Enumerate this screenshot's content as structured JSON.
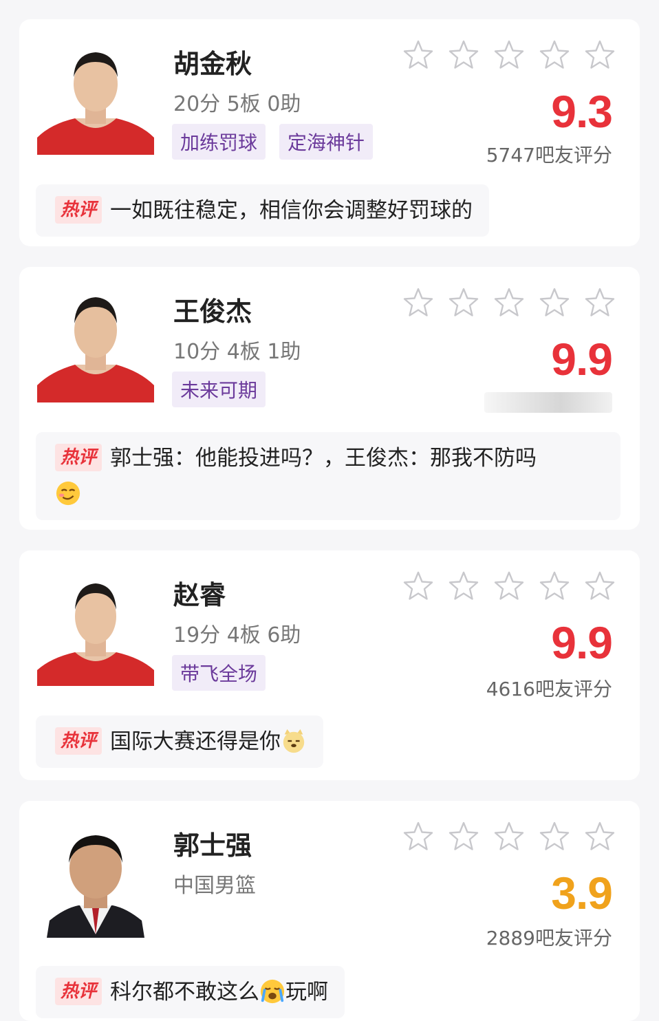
{
  "colors": {
    "score_high": "#e8323a",
    "score_low": "#f0a21c",
    "tag_bg": "#f1ecf8",
    "tag_text": "#6b3a9b",
    "hot_bg": "#fde3e3",
    "hot_text": "#e8323a"
  },
  "star_icon": "star-outline-icon",
  "hot_label": "热评",
  "players": [
    {
      "name": "胡金秋",
      "stats": "20分 5板 0助",
      "tags": [
        "加练罚球",
        "定海神针"
      ],
      "score": "9.3",
      "raters": "5747吧友评分",
      "comment": "一如既往稳定，相信你会调整好罚球的"
    },
    {
      "name": "王俊杰",
      "stats": "10分 4板 1助",
      "tags": [
        "未来可期"
      ],
      "score": "9.9",
      "raters": "",
      "comment": "郭士强：他能投进吗？，王俊杰：那我不防吗",
      "comment_emoji": "smirk-emoji"
    },
    {
      "name": "赵睿",
      "stats": "19分 4板 6助",
      "tags": [
        "带飞全场"
      ],
      "score": "9.9",
      "raters": "4616吧友评分",
      "comment": "国际大赛还得是你",
      "comment_emoji": "dog-face-emoji"
    },
    {
      "name": "郭士强",
      "stats": "中国男篮",
      "tags": [],
      "score": "3.9",
      "raters": "2889吧友评分",
      "comment_part1": "科尔都不敢这么",
      "comment_emoji": "crying-emoji",
      "comment_part2": "玩啊"
    }
  ]
}
